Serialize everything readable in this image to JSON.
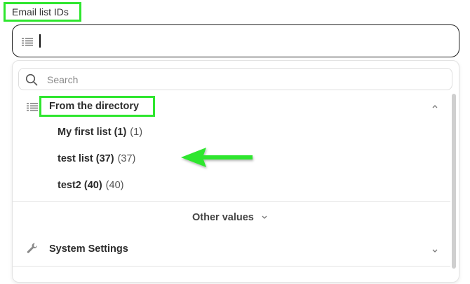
{
  "field": {
    "label": "Email list IDs",
    "value": ""
  },
  "dropdown": {
    "search_placeholder": "Search",
    "group": {
      "title": "From the directory",
      "options": [
        {
          "label": "My first list (1)",
          "count": "(1)"
        },
        {
          "label": "test list (37)",
          "count": "(37)"
        },
        {
          "label": "test2 (40)",
          "count": "(40)"
        }
      ]
    },
    "other_values_label": "Other values",
    "system_settings_label": "System Settings"
  },
  "colors": {
    "highlight": "#2ee62e",
    "arrow": "#2ee62e",
    "border": "#1f1f1f"
  },
  "icons": [
    "list-icon",
    "search-icon",
    "chevron-up-icon",
    "chevron-down-icon",
    "wrench-icon",
    "arrow-left-icon"
  ]
}
